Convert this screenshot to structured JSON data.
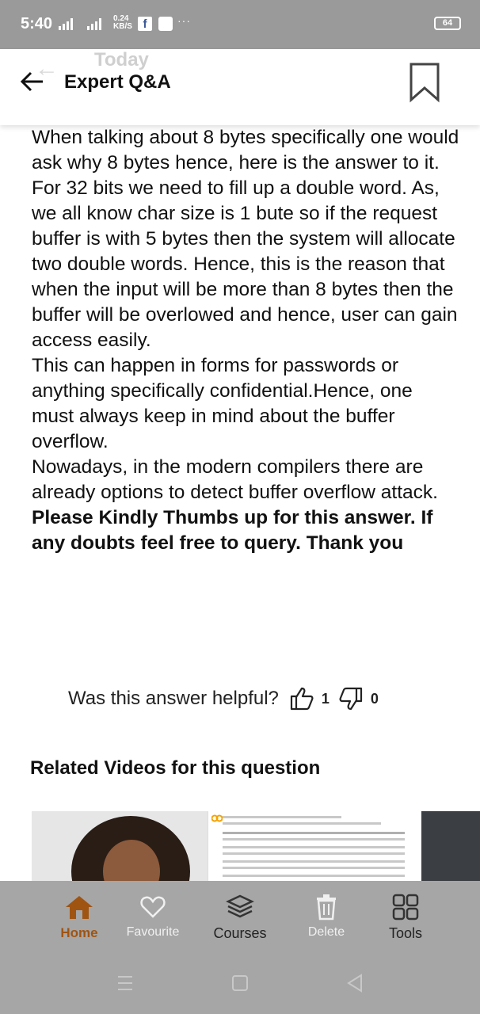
{
  "status_bar": {
    "time": "5:40",
    "net_rate_value": "0.24",
    "net_rate_unit": "KB/S",
    "fb_label": "f",
    "dots": "···",
    "battery": "64"
  },
  "header": {
    "ghost_title": "Today",
    "title": "Expert Q&A"
  },
  "answer": {
    "paragraphs": [
      "When talking about 8 bytes specifically one would ask why 8 bytes hence, here is the answer to it.",
      "For 32 bits we need to fill up a double word. As, we all know char size is 1 bute so if the request buffer is with 5 bytes then the system will allocate two double words. Hence, this is the reason that when the input will be more than 8 bytes then the buffer will be overlowed and hence, user can gain access easily.",
      "This can happen in forms for passwords or anything specifically confidential.Hence, one must always keep in mind about the buffer overflow.",
      "Nowadays, in the modern compilers there are already options to detect buffer overflow attack."
    ],
    "closing": "Please Kindly Thumbs up for this answer. If any doubts feel free to query. Thank you"
  },
  "feedback": {
    "question": "Was this answer helpful?",
    "thumbs_up_count": "1",
    "thumbs_down_count": "0"
  },
  "related": {
    "heading": "Related Videos for this question"
  },
  "toolbar": {
    "home": "Home",
    "favourite": "Favourite",
    "courses": "Courses",
    "delete": "Delete",
    "tools": "Tools"
  },
  "icons": {
    "back": "arrow-left-icon",
    "bookmark": "bookmark-icon",
    "thumbs_up": "thumbs-up-icon",
    "thumbs_down": "thumbs-down-icon",
    "home": "home-icon",
    "favourite": "heart-icon",
    "courses": "courses-icon",
    "delete": "trash-icon",
    "tools": "grid-icon"
  },
  "colors": {
    "status_bar": "#9a9a9a",
    "toolbar": "#a6a6a6",
    "home_accent": "#a05412"
  }
}
